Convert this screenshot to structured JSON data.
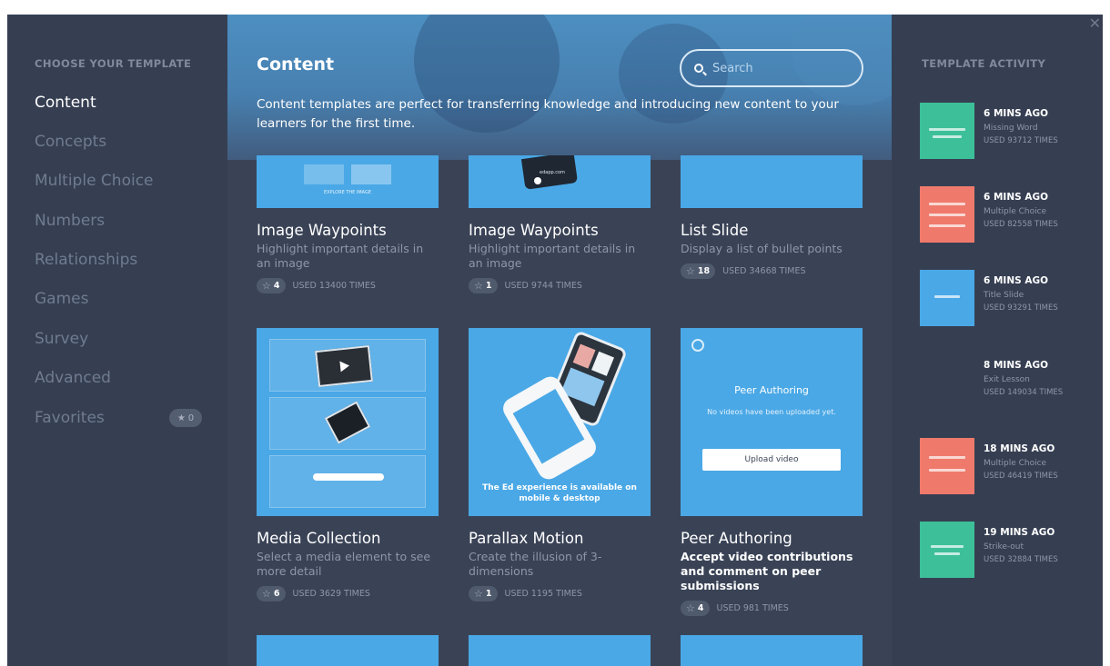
{
  "sidebar": {
    "title": "CHOOSE YOUR TEMPLATE",
    "items": [
      {
        "label": "Content"
      },
      {
        "label": "Concepts"
      },
      {
        "label": "Multiple Choice"
      },
      {
        "label": "Numbers"
      },
      {
        "label": "Relationships"
      },
      {
        "label": "Games"
      },
      {
        "label": "Survey"
      },
      {
        "label": "Advanced"
      },
      {
        "label": "Favorites"
      }
    ],
    "favorites_count": "0"
  },
  "header": {
    "title": "Content",
    "description": "Content templates are perfect for transferring knowledge and introducing new content to your learners for the first time.",
    "search_placeholder": "Search"
  },
  "cards": [
    {
      "name": "Image Waypoints",
      "desc": "Highlight important details in an image",
      "stars": "4",
      "used": "USED 13400 TIMES",
      "thumb_caption": "EXPLORE THE IMAGE"
    },
    {
      "name": "Image Waypoints",
      "desc": "Highlight important details in an image",
      "stars": "1",
      "used": "USED 9744 TIMES",
      "thumb_caption": "edapp.com"
    },
    {
      "name": "List Slide",
      "desc": "Display a list of bullet points",
      "stars": "18",
      "used": "USED 34668 TIMES"
    },
    {
      "name": "Media Collection",
      "desc": "Select a media element to see more detail",
      "stars": "6",
      "used": "USED 3629 TIMES"
    },
    {
      "name": "Parallax Motion",
      "desc": "Create the illusion of 3-dimensions",
      "stars": "1",
      "used": "USED 1195 TIMES",
      "thumb_caption": "The Ed experience is available on mobile & desktop"
    },
    {
      "name": "Peer Authoring",
      "desc": "Accept video contributions and comment on peer submissions",
      "stars": "4",
      "used": "USED 981 TIMES",
      "thumb_title": "Peer Authoring",
      "thumb_sub": "No videos have been uploaded yet.",
      "thumb_button": "Upload video"
    }
  ],
  "activity": {
    "title": "TEMPLATE ACTIVITY",
    "items": [
      {
        "time": "6 MINS AGO",
        "name": "Missing Word",
        "used": "USED 93712 TIMES",
        "color": "#3dbf9a"
      },
      {
        "time": "6 MINS AGO",
        "name": "Multiple Choice",
        "used": "USED 82558 TIMES",
        "color": "#ef7a6c"
      },
      {
        "time": "6 MINS AGO",
        "name": "Title Slide",
        "used": "USED 93291 TIMES",
        "color": "#4aa8e6"
      },
      {
        "time": "8 MINS AGO",
        "name": "Exit Lesson",
        "used": "USED 149034 TIMES",
        "color": "#363f52"
      },
      {
        "time": "18 MINS AGO",
        "name": "Multiple Choice",
        "used": "USED 46419 TIMES",
        "color": "#ef7a6c"
      },
      {
        "time": "19 MINS AGO",
        "name": "Strike-out",
        "used": "USED 32884 TIMES",
        "color": "#3dbf9a"
      }
    ]
  }
}
